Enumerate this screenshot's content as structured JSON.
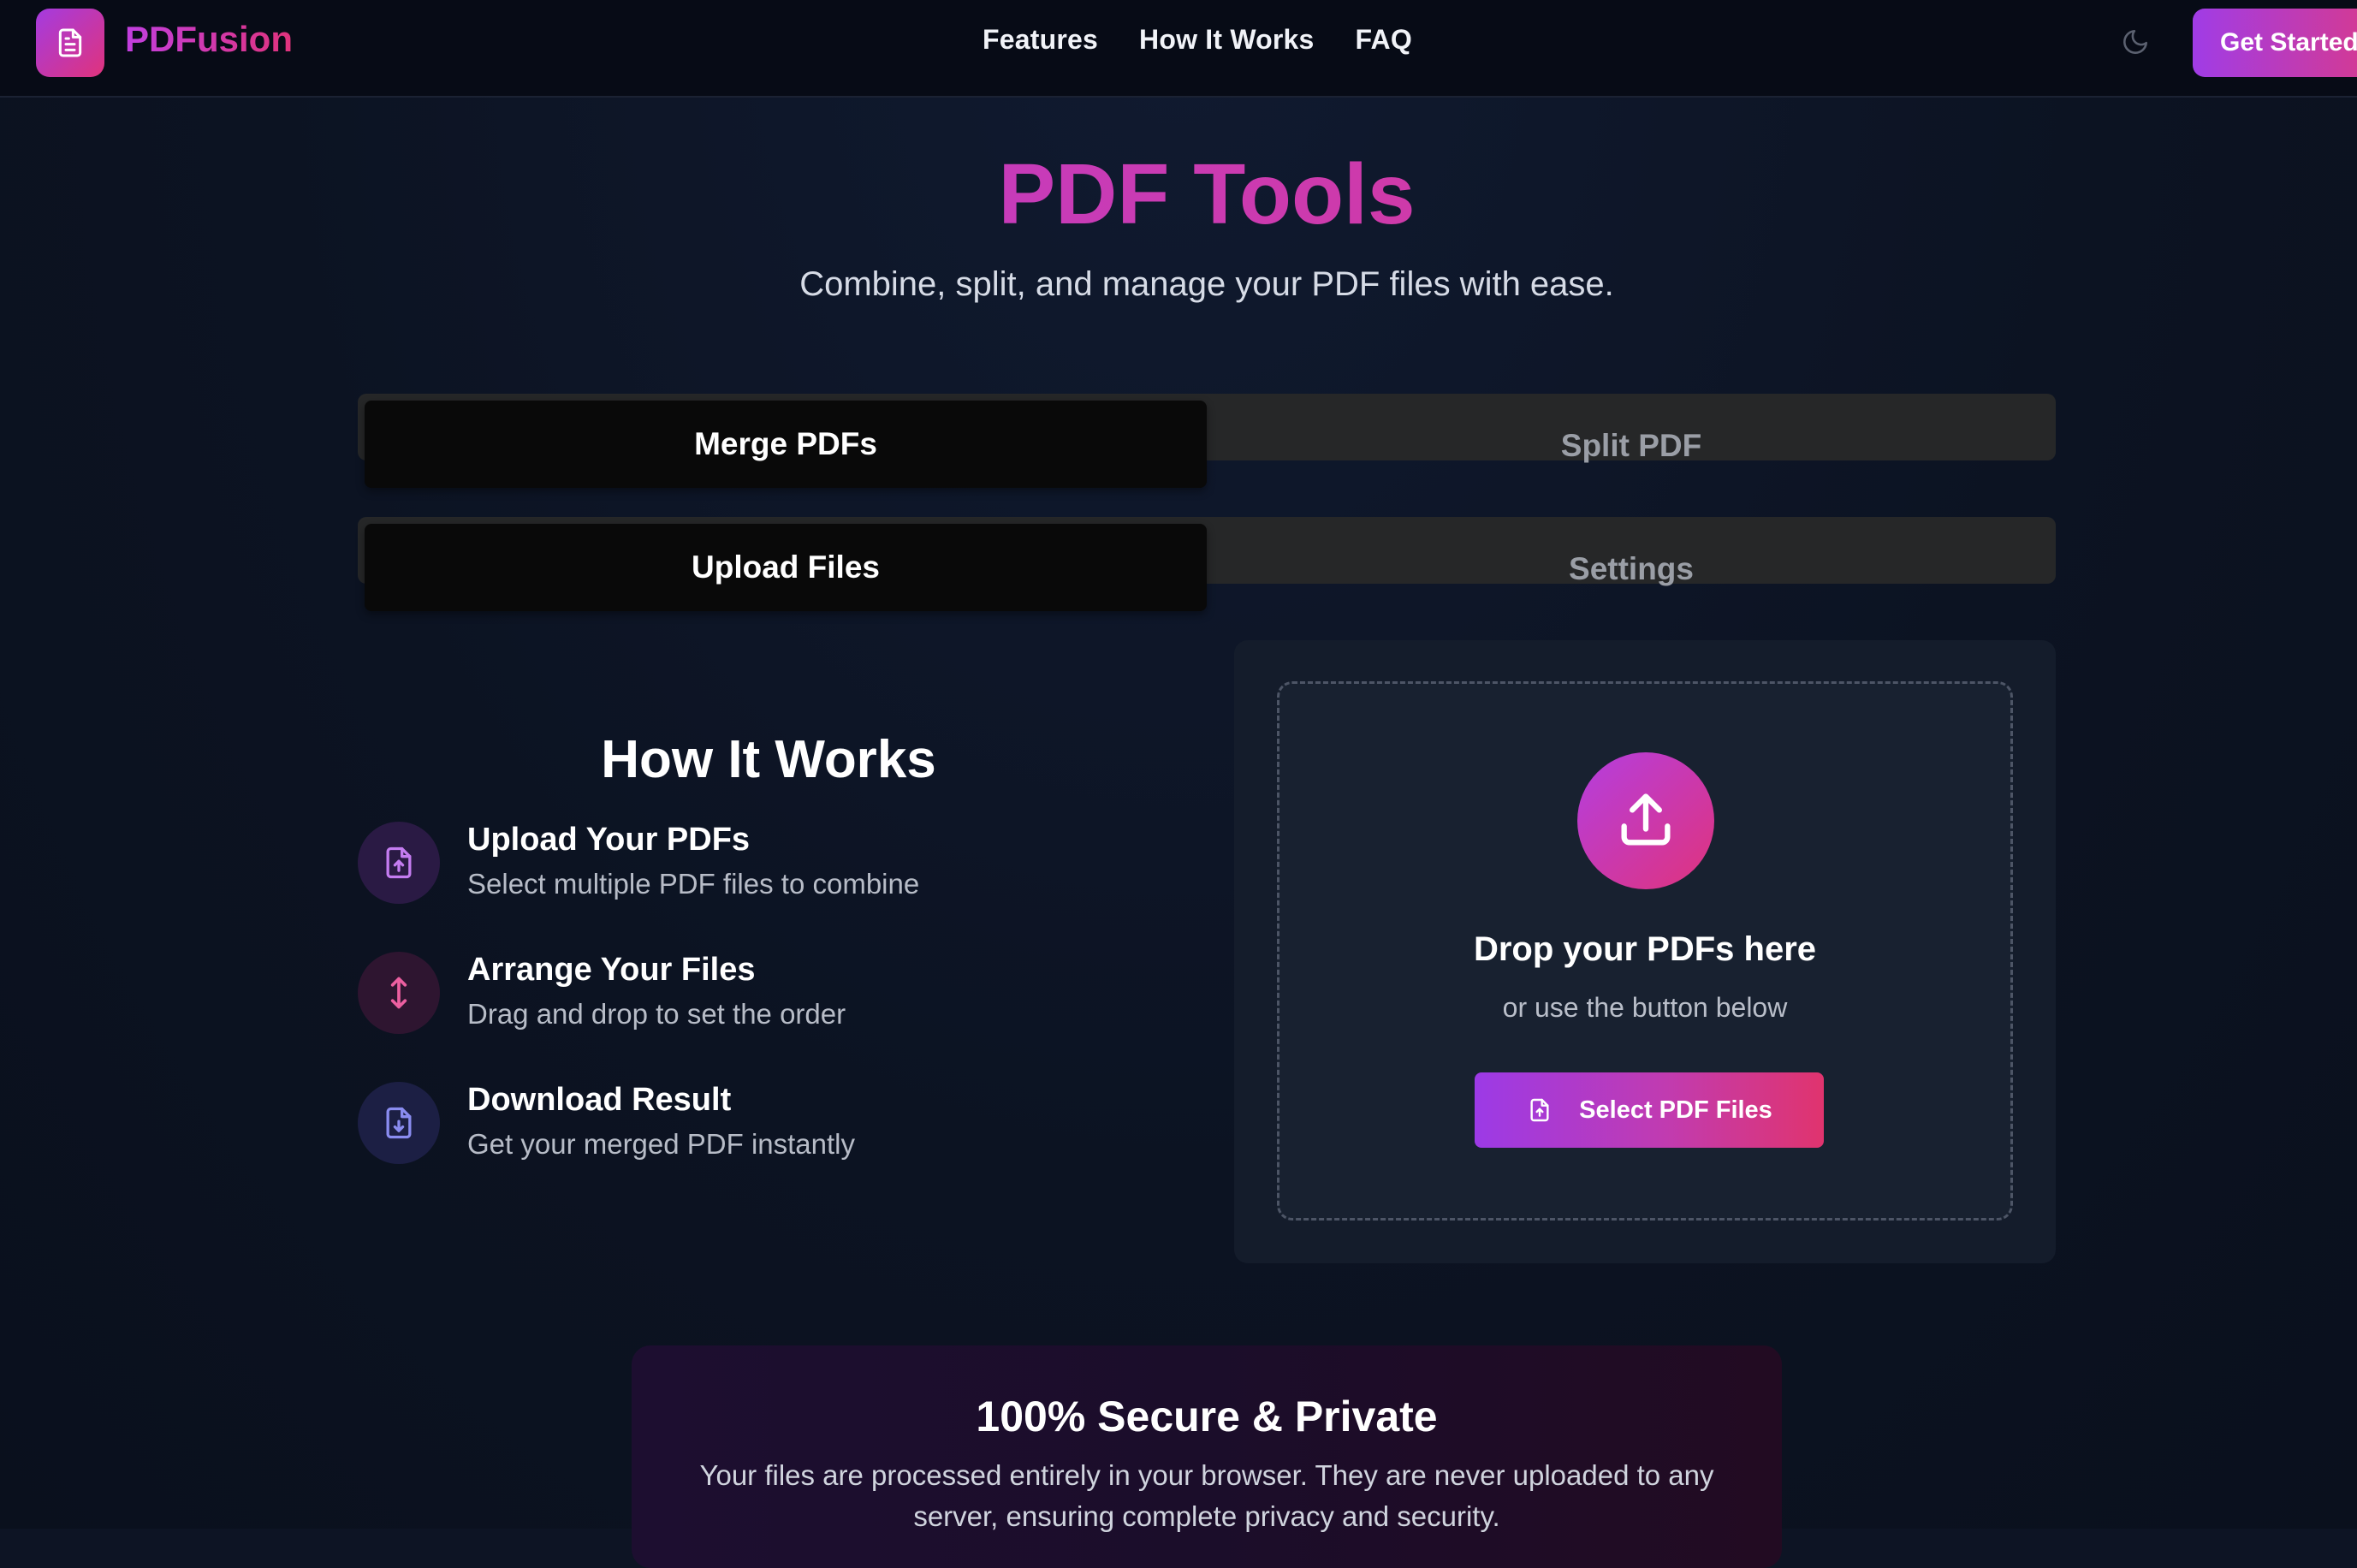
{
  "header": {
    "brand": "PDFusion",
    "nav": [
      "Features",
      "How It Works",
      "FAQ"
    ],
    "cta": "Get Started"
  },
  "hero": {
    "title": "PDF Tools",
    "subtitle": "Combine, split, and manage your PDF files with ease."
  },
  "mode_tabs": {
    "active": "Merge PDFs",
    "inactive": "Split PDF"
  },
  "sub_tabs": {
    "active": "Upload Files",
    "inactive": "Settings"
  },
  "how_it_works": {
    "title": "How It Works",
    "steps": [
      {
        "title": "Upload Your PDFs",
        "desc": "Select multiple PDF files to combine",
        "icon": "file-upload-icon"
      },
      {
        "title": "Arrange Your Files",
        "desc": "Drag and drop to set the order",
        "icon": "arrows-vertical-icon"
      },
      {
        "title": "Download Result",
        "desc": "Get your merged PDF instantly",
        "icon": "file-download-icon"
      }
    ]
  },
  "upload": {
    "title": "Drop your PDFs here",
    "subtitle": "or use the button below",
    "button": "Select PDF Files"
  },
  "secure": {
    "title": "100% Secure & Private",
    "text": "Your files are processed entirely in your browser. They are never uploaded to any server, ensuring complete privacy and security."
  },
  "colors": {
    "accent_start": "#a43be0",
    "accent_end": "#e0337c",
    "background": "#0d1424",
    "card": "#141c2b"
  }
}
